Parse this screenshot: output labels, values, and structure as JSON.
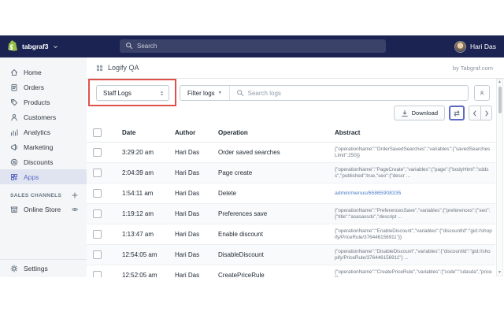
{
  "topbar": {
    "store_name": "tabgraf3",
    "search_placeholder": "Search",
    "user_name": "Hari Das"
  },
  "sidebar": {
    "items": [
      {
        "label": "Home",
        "icon": "home-icon",
        "selected": false
      },
      {
        "label": "Orders",
        "icon": "orders-icon",
        "selected": false
      },
      {
        "label": "Products",
        "icon": "products-icon",
        "selected": false
      },
      {
        "label": "Customers",
        "icon": "customers-icon",
        "selected": false
      },
      {
        "label": "Analytics",
        "icon": "analytics-icon",
        "selected": false
      },
      {
        "label": "Marketing",
        "icon": "marketing-icon",
        "selected": false
      },
      {
        "label": "Discounts",
        "icon": "discounts-icon",
        "selected": false
      },
      {
        "label": "Apps",
        "icon": "apps-icon",
        "selected": true
      }
    ],
    "sales_channels_label": "SALES CHANNELS",
    "online_store_label": "Online Store",
    "settings_label": "Settings"
  },
  "header": {
    "app_title": "Logify QA",
    "byline": "by Tabgraf.com"
  },
  "filters": {
    "log_type_value": "Staff Logs",
    "filter_button_label": "Filter logs",
    "search_placeholder": "Search logs"
  },
  "actions": {
    "download_label": "Download"
  },
  "table": {
    "columns": [
      "Date",
      "Author",
      "Operation",
      "Abstract"
    ],
    "rows": [
      {
        "date": "3:29:20 am",
        "author": "Hari Das",
        "operation": "Order saved searches",
        "abstract": "{\"operationName\":\"OrderSavedSearches\",\"variables\":{\"savedSearchesLimit\":250}}",
        "is_link": false
      },
      {
        "date": "2:04:39 am",
        "author": "Hari Das",
        "operation": "Page create",
        "abstract": "{\"operationName\":\"PageCreate\",\"variables\":{\"page\":{\"bodyHtml\":\"sddss\",\"published\":true,\"seo\":{\"descr ...",
        "is_link": false
      },
      {
        "date": "1:54:11 am",
        "author": "Hari Das",
        "operation": "Delete",
        "abstract": "admin/menus/65865908335",
        "is_link": true
      },
      {
        "date": "1:19:12 am",
        "author": "Hari Das",
        "operation": "Preferences save",
        "abstract": "{\"operationName\":\"PreferencesSave\",\"variables\":{\"preferences\":{\"seo\":{\"title\":\"asasassds\",\"descript ...",
        "is_link": false
      },
      {
        "date": "1:13:47 am",
        "author": "Hari Das",
        "operation": "Enable discount",
        "abstract": "{\"operationName\":\"EnableDiscount\",\"variables\":{\"discountId\":\"gid://shopify/PriceRule/376446156911\"}}",
        "is_link": false
      },
      {
        "date": "12:54:05 am",
        "author": "Hari Das",
        "operation": "DisableDiscount",
        "abstract": "{\"operationName\":\"DisableDiscount\",\"variables\":{\"discountId\":\"gid://shopify/PriceRule/376446156911\"} ...",
        "is_link": false
      },
      {
        "date": "12:52:05 am",
        "author": "Hari Das",
        "operation": "CreatePriceRule",
        "abstract": "{\"operationName\":\"CreatePriceRule\",\"variables\":{\"code\":\"sdasda\",\"priceR ...",
        "is_link": false
      }
    ]
  },
  "colors": {
    "topbar": "#1a2352",
    "sidebar_bg": "#f4f6f8",
    "accent": "#5c6ac4",
    "annotation": "#dd524c",
    "link": "#4a7cc7",
    "logo_green": "#95bf47"
  }
}
